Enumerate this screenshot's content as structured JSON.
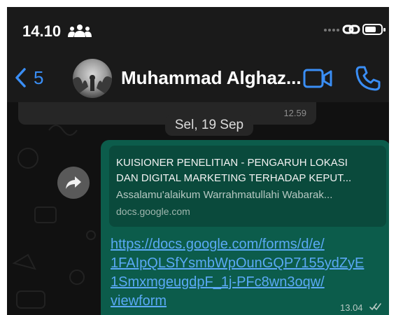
{
  "status_bar": {
    "time": "14.10",
    "icons": [
      "people-icon",
      "signal-dots-icon",
      "link-icon",
      "battery-icon"
    ]
  },
  "nav": {
    "back_count": "5",
    "contact_name": "Muhammad Alghaz...",
    "icons": [
      "back-chevron-icon",
      "video-call-icon",
      "phone-call-icon"
    ]
  },
  "chat": {
    "prev_message_time": "12.59",
    "date_divider": "Sel, 19 Sep",
    "message": {
      "preview_title": "KUISIONER PENELITIAN - PENGARUH LOKASI\nDAN DIGITAL MARKETING TERHADAP KEPUT...",
      "preview_description": "Assalamu'alaikum Warrahmatullahi Wabarak...",
      "preview_domain": "docs.google.com",
      "link_text": "https://docs.google.com/forms/d/e/\n1FAIpQLSfYsmbWpOunGQP7155ydZyE\n1SmxmgeugdpF_1j-PFc8wn3oqw/\nviewform",
      "time": "13.04",
      "status_icon": "double-check-icon"
    }
  },
  "colors": {
    "accent_blue": "#3a8ef5",
    "bubble_green": "#0c5c4b",
    "link_blue": "#5aa9f5"
  }
}
